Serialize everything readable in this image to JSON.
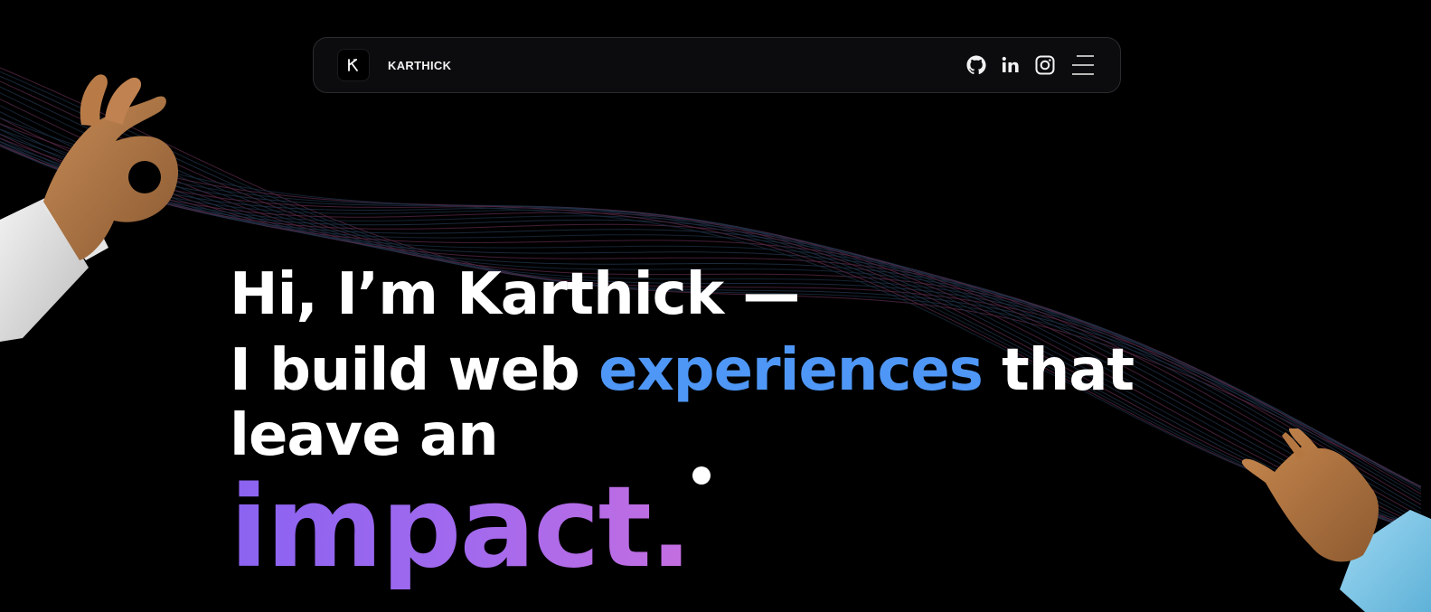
{
  "navbar": {
    "logo_letter": "K",
    "brand": "KARTHICK",
    "icons": [
      "github-icon",
      "linkedin-icon",
      "instagram-icon",
      "menu-icon"
    ]
  },
  "hero": {
    "line1": "Hi, I’m Karthick —",
    "line2_pre": "I build web ",
    "line2_accent": "experiences",
    "line2_post": " that",
    "line3": "leave an",
    "impact": "impact."
  },
  "colors": {
    "background": "#000000",
    "accent": "#4f97f6",
    "impact_gradient_start": "#8a63f0",
    "impact_gradient_end": "#c46ee0"
  }
}
